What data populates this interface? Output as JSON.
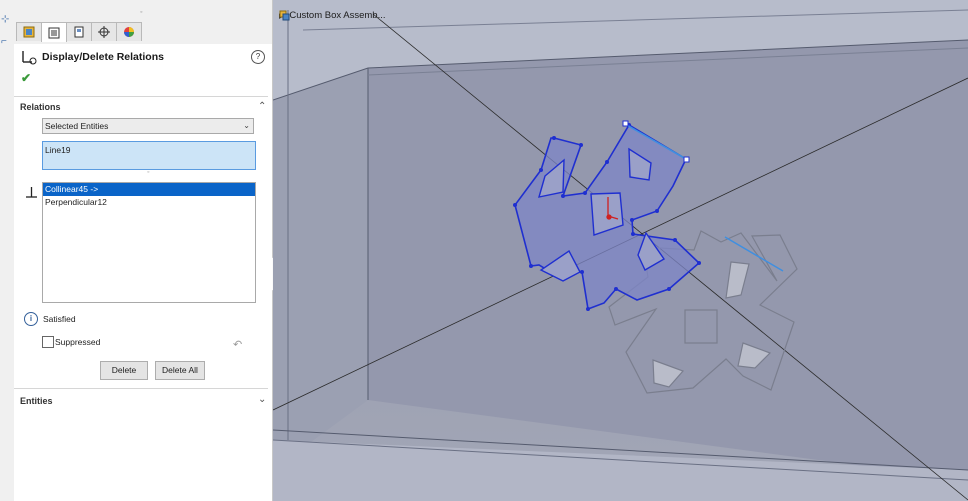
{
  "property_manager": {
    "title": "Display/Delete Relations",
    "tabs": [
      "feature-manager-tab",
      "property-manager-tab",
      "configuration-manager-tab",
      "dim-xpert-tab",
      "display-manager-tab"
    ],
    "relations_section": {
      "title": "Relations",
      "filter_value": "Selected Entities",
      "selected_entity": "Line19",
      "relations": [
        {
          "label": "Collinear45 ->",
          "selected": true
        },
        {
          "label": "Perpendicular12",
          "selected": false
        }
      ],
      "status": "Satisfied",
      "suppressed_label": "Suppressed",
      "suppressed_checked": false,
      "delete_label": "Delete",
      "delete_all_label": "Delete All"
    },
    "entities_section": {
      "title": "Entities"
    }
  },
  "graphics_area": {
    "tree_flyout_label": "Custom Box Assemb...",
    "highlight_color": "#1f2fd0",
    "sketch_fill_color": "#7d86c7",
    "model_color": "#9aa0b4"
  }
}
